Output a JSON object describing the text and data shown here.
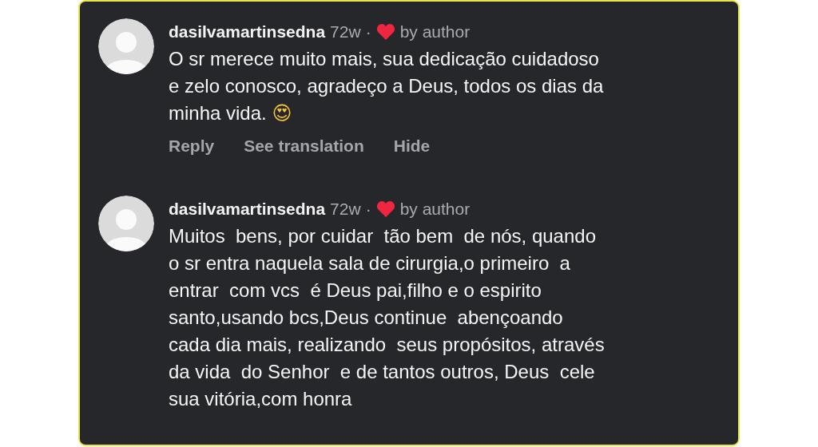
{
  "comments": [
    {
      "username": "dasilvamartinsedna",
      "time": "72w",
      "separator": "·",
      "author_liked": true,
      "liked_label": "by author",
      "lines": [
        "O sr merece muito mais, sua dedicação cuidadoso",
        "e zelo conosco, agradeço a Deus, todos os dias da",
        "minha vida."
      ],
      "trailing_emoji": "😍",
      "actions": [
        "Reply",
        "See translation",
        "Hide"
      ]
    },
    {
      "username": "dasilvamartinsedna",
      "time": "72w",
      "separator": "·",
      "author_liked": true,
      "liked_label": "by author",
      "lines": [
        "Muitos  bens, por cuidar  tão bem  de nós, quando",
        "o sr entra naquela sala de cirurgia,o primeiro  a",
        "entrar  com vcs  é Deus pai,filho e o espirito",
        "santo,usando bcs,Deus continue  abençoando",
        "cada dia mais, realizando  seus propósitos, através",
        "da vida  do Senhor  e de tantos outros, Deus  cele",
        "sua vitória,com honra"
      ]
    }
  ]
}
